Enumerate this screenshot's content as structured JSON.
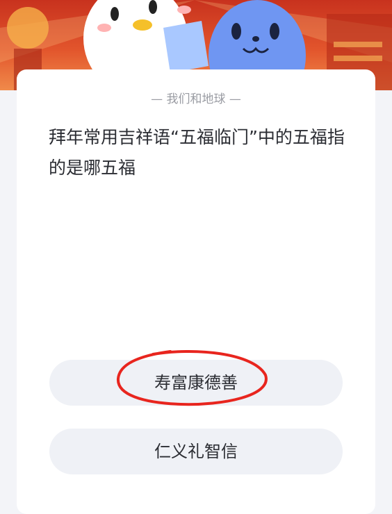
{
  "card": {
    "subtitle": "— 我们和地球 —",
    "question": "拜年常用吉祥语“五福临门”中的五福指的是哪五福"
  },
  "options": [
    {
      "label": "寿富康德善"
    },
    {
      "label": "仁义礼智信"
    }
  ],
  "colors": {
    "banner_red": "#d9432a",
    "highlight_circle": "#e8251e",
    "option_bg": "#eff1f6"
  },
  "icons": [
    "white-penguin-mascot",
    "blue-mascot"
  ]
}
